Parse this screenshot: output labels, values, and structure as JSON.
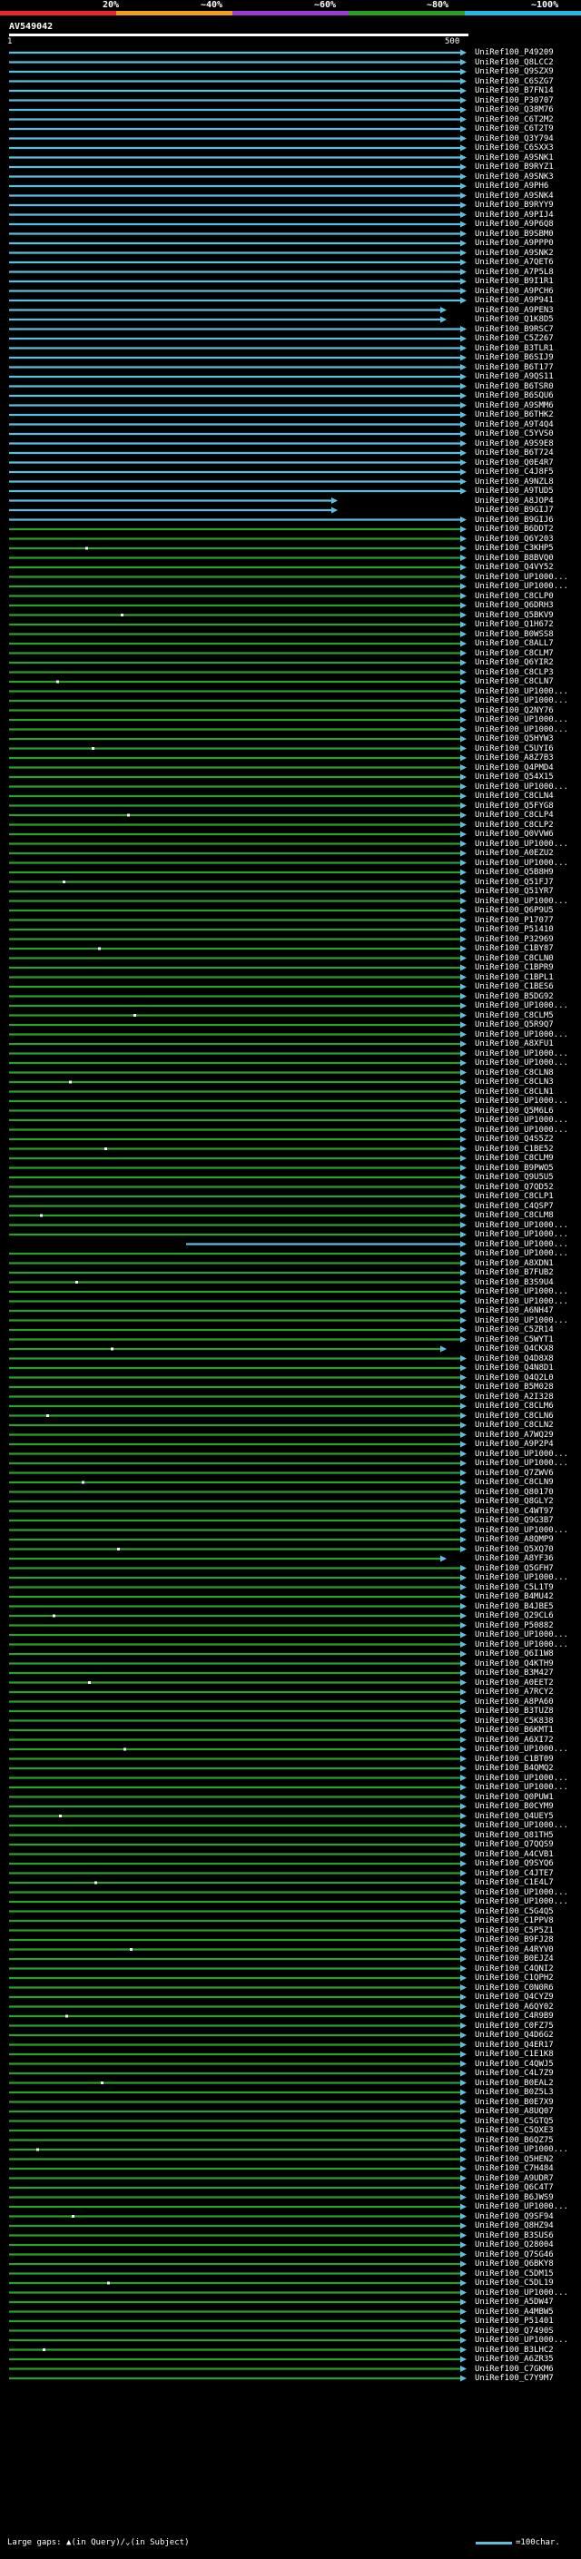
{
  "scale": {
    "labels": [
      "20%",
      "~40%",
      "~60%",
      "~80%",
      "~100%"
    ],
    "segment_colors": [
      "#e8262b",
      "#f0a020",
      "#9b3bd0",
      "#27a020",
      "#26b8e0"
    ]
  },
  "query": {
    "id": "AV549042",
    "start": "1",
    "end": "500"
  },
  "colors": {
    "high_identity": "#5bc0de",
    "mid_identity": "#2ca02c",
    "arrow": "#5bc0de",
    "gap": "#111111"
  },
  "hits": [
    "UniRef100_P49209",
    "UniRef100_Q8LCC2",
    "UniRef100_Q9SZX9",
    "UniRef100_C6SZG7",
    "UniRef100_B7FN14",
    "UniRef100_P30707",
    "UniRef100_Q38M76",
    "UniRef100_C6T2M2",
    "UniRef100_C6T2T9",
    "UniRef100_Q3Y794",
    "UniRef100_C6SXX3",
    "UniRef100_A9SNK1",
    "UniRef100_B9RYZ1",
    "UniRef100_A9SNK3",
    "UniRef100_A9PH6",
    "UniRef100_A9SNK4",
    "UniRef100_B9RYY9",
    "UniRef100_A9PIJ4",
    "UniRef100_A9P6Q8",
    "UniRef100_B9SBM0",
    "UniRef100_A9PPP0",
    "UniRef100_A9SNK2",
    "UniRef100_A7QET6",
    "UniRef100_A7P5L8",
    "UniRef100_B9I1R1",
    "UniRef100_A9PCH6",
    "UniRef100_A9P941",
    "UniRef100_A9PEN3",
    "UniRef100_Q1K8D5",
    "UniRef100_B9RSC7",
    "UniRef100_C5Z267",
    "UniRef100_B3TLR1",
    "UniRef100_B6SIJ9",
    "UniRef100_B6T177",
    "UniRef100_A9QS11",
    "UniRef100_B6TSR0",
    "UniRef100_B6SQU6",
    "UniRef100_A9SMM6",
    "UniRef100_B6THK2",
    "UniRef100_A9T4Q4",
    "UniRef100_C5YVS0",
    "UniRef100_A9S9E8",
    "UniRef100_B6T724",
    "UniRef100_Q0E4R7",
    "UniRef100_C4J8F5",
    "UniRef100_A9NZL8",
    "UniRef100_A9TUD5",
    "UniRef100_A8JOP4",
    "UniRef100_B9GIJ7",
    "UniRef100_B9GIJ6",
    "UniRef100_B6DDT2",
    "UniRef100_Q6Y203",
    "UniRef100_C3KHP5",
    "UniRef100_B8BVQ0",
    "UniRef100_Q4VY52",
    "UniRef100_UP1000...",
    "UniRef100_UP1000...",
    "UniRef100_C8CLP0",
    "UniRef100_Q6DRH3",
    "UniRef100_Q5BKV9",
    "UniRef100_Q1H672",
    "UniRef100_B0WSS8",
    "UniRef100_C8ALL7",
    "UniRef100_C8CLM7",
    "UniRef100_Q6YIR2",
    "UniRef100_C8CLP3",
    "UniRef100_C8CLN7",
    "UniRef100_UP1000...",
    "UniRef100_UP1000...",
    "UniRef100_Q2NY76",
    "UniRef100_UP1000...",
    "UniRef100_UP1000...",
    "UniRef100_Q5HYW3",
    "UniRef100_C5UYI6",
    "UniRef100_A8Z7B3",
    "UniRef100_Q4PMD4",
    "UniRef100_Q54X15",
    "UniRef100_UP1000...",
    "UniRef100_C8CLN4",
    "UniRef100_Q5FYG8",
    "UniRef100_C8CLP4",
    "UniRef100_C8CLP2",
    "UniRef100_Q0VVW6",
    "UniRef100_UP1000...",
    "UniRef100_A0EZU2",
    "UniRef100_UP1000...",
    "UniRef100_Q5B8H9",
    "UniRef100_Q51FJ7",
    "UniRef100_Q51YR7",
    "UniRef100_UP1000...",
    "UniRef100_Q6P9U5",
    "UniRef100_P17077",
    "UniRef100_P51410",
    "UniRef100_P32969",
    "UniRef100_C1BY87",
    "UniRef100_C8CLN0",
    "UniRef100_C1BPR9",
    "UniRef100_C1BPL1",
    "UniRef100_C1BES6",
    "UniRef100_B5DG92",
    "UniRef100_UP1000...",
    "UniRef100_C8CLM5",
    "UniRef100_Q5R9Q7",
    "UniRef100_UP1000...",
    "UniRef100_A8XFU1",
    "UniRef100_UP1000...",
    "UniRef100_UP1000...",
    "UniRef100_C8CLN8",
    "UniRef100_C8CLN3",
    "UniRef100_C8CLN1",
    "UniRef100_UP1000...",
    "UniRef100_Q5M6L6",
    "UniRef100_UP1000...",
    "UniRef100_UP1000...",
    "UniRef100_Q4S5Z2",
    "UniRef100_C1BE52",
    "UniRef100_C8CLM9",
    "UniRef100_B9PWO5",
    "UniRef100_Q9U5U5",
    "UniRef100_Q7QD52",
    "UniRef100_C8CLP1",
    "UniRef100_C4QSP7",
    "UniRef100_C8CLM8",
    "UniRef100_UP1000...",
    "UniRef100_UP1000...",
    "UniRef100_UP1000...",
    "UniRef100_UP1000...",
    "UniRef100_A8XDN1",
    "UniRef100_B7FUB2",
    "UniRef100_B3S9U4",
    "UniRef100_UP1000...",
    "UniRef100_UP1000...",
    "UniRef100_A6NH47",
    "UniRef100_UP1000...",
    "UniRef100_C5ZR14",
    "UniRef100_C5WYT1",
    "UniRef100_Q4CKX8",
    "UniRef100_Q4D8X8",
    "UniRef100_Q4N8D1",
    "UniRef100_Q4Q2L0",
    "UniRef100_B5M028",
    "UniRef100_A2I328",
    "UniRef100_C8CLM6",
    "UniRef100_C8CLN6",
    "UniRef100_C8CLN2",
    "UniRef100_A7WQ29",
    "UniRef100_A9P2P4",
    "UniRef100_UP1000...",
    "UniRef100_UP1000...",
    "UniRef100_Q7ZWV6",
    "UniRef100_C8CLN9",
    "UniRef100_Q80170",
    "UniRef100_Q8GLY2",
    "UniRef100_C4WT97",
    "UniRef100_Q9G3B7",
    "UniRef100_UP1000...",
    "UniRef100_A8QMP9",
    "UniRef100_Q5XQ70",
    "UniRef100_A8YF36",
    "UniRef100_Q5GFH7",
    "UniRef100_UP1000...",
    "UniRef100_C5L1T9",
    "UniRef100_B4MU42",
    "UniRef100_B4JBE5",
    "UniRef100_Q29CL6",
    "UniRef100_P50882",
    "UniRef100_UP1000...",
    "UniRef100_UP1000...",
    "UniRef100_Q6I1W8",
    "UniRef100_Q4KTH9",
    "UniRef100_B3M427",
    "UniRef100_A0EET2",
    "UniRef100_A7RCY2",
    "UniRef100_A8PA60",
    "UniRef100_B3TUZ8",
    "UniRef100_C5K838",
    "UniRef100_B6KMT1",
    "UniRef100_A6XI72",
    "UniRef100_UP1000...",
    "UniRef100_C1BT09",
    "UniRef100_B4QMQ2",
    "UniRef100_UP1000...",
    "UniRef100_UP1000...",
    "UniRef100_Q0PUW1",
    "UniRef100_B0CYM9",
    "UniRef100_Q4UEY5",
    "UniRef100_UP1000...",
    "UniRef100_Q81TH5",
    "UniRef100_Q7QQS9",
    "UniRef100_A4CVB1",
    "UniRef100_Q9SYQ6",
    "UniRef100_C4JTE7",
    "UniRef100_C1E4L7",
    "UniRef100_UP1000...",
    "UniRef100_UP1000...",
    "UniRef100_C5G4Q5",
    "UniRef100_C1PPV8",
    "UniRef100_C5P5Z1",
    "UniRef100_B9FJ28",
    "UniRef100_A4RYV0",
    "UniRef100_B0EJZ4",
    "UniRef100_C4QNI2",
    "UniRef100_C1QPH2",
    "UniRef100_C0N0R6",
    "UniRef100_Q4CYZ9",
    "UniRef100_A6QY02",
    "UniRef100_C4R9B9",
    "UniRef100_C0FZ75",
    "UniRef100_Q4D6G2",
    "UniRef100_Q4ER17",
    "UniRef100_C1E1K8",
    "UniRef100_C4QWJ5",
    "UniRef100_C4L7Z9",
    "UniRef100_B0EAL2",
    "UniRef100_B0Z5L3",
    "UniRef100_B0E7X9",
    "UniRef100_A8UQ07",
    "UniRef100_C5GTQ5",
    "UniRef100_C5QXE3",
    "UniRef100_B6QZ75",
    "UniRef100_UP1000...",
    "UniRef100_Q5HEN2",
    "UniRef100_C7H484",
    "UniRef100_A9UDR7",
    "UniRef100_Q6C4T7",
    "UniRef100_B6JWS9",
    "UniRef100_UP1000...",
    "UniRef100_Q9SF94",
    "UniRef100_Q8HZ94",
    "UniRef100_B3SUS6",
    "UniRef100_Q28004",
    "UniRef100_Q7SG46",
    "UniRef100_Q6BKY8",
    "UniRef100_C5DM15",
    "UniRef100_C5DL19",
    "UniRef100_UP1000...",
    "UniRef100_A5DW47",
    "UniRef100_A4MBW5",
    "UniRef100_P51401",
    "UniRef100_Q7490S",
    "UniRef100_UP1000...",
    "UniRef100_B3LHC2",
    "UniRef100_A6ZR35",
    "UniRef100_C7GKM6",
    "UniRef100_C7Y9M7"
  ],
  "footer": {
    "large_gaps_text": "Large gaps: ▲(in Query)/⌄(in Subject)",
    "legend_text": "=100char."
  }
}
